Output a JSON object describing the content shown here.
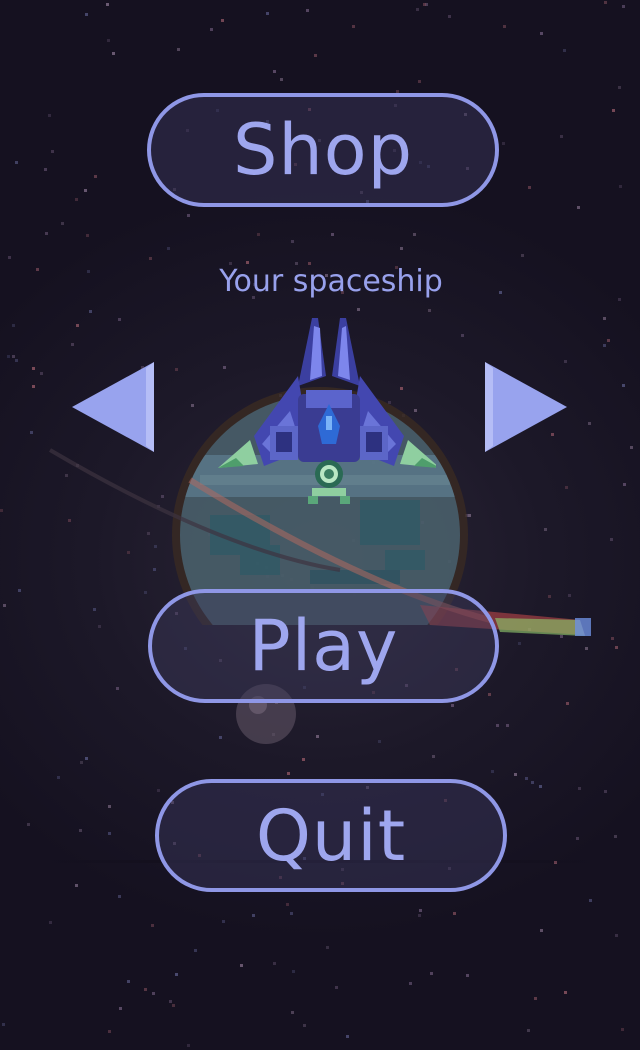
{
  "menu": {
    "shop_label": "Shop",
    "play_label": "Play",
    "quit_label": "Quit"
  },
  "selector": {
    "title": "Your spaceship",
    "prev_icon": "arrow-left-icon",
    "next_icon": "arrow-right-icon"
  },
  "colors": {
    "accent": "#8f97e6",
    "text": "#9ea6ee",
    "background": "#171322"
  }
}
